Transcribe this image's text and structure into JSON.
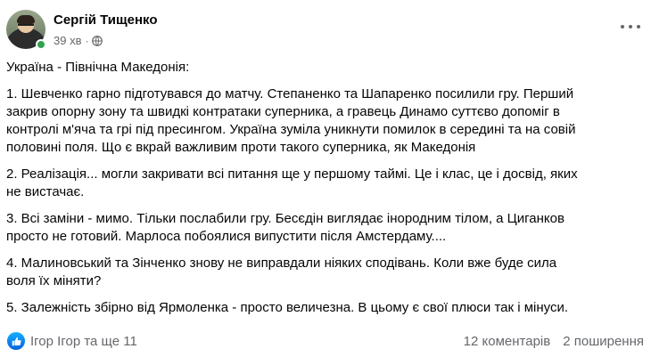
{
  "post": {
    "author": "Сергій Тищенко",
    "time": "39 хв",
    "separator": "·",
    "privacy_icon": "globe-icon",
    "more_icon": "more-options-icon",
    "paragraphs": [
      "Україна - Північна Македонія:",
      "1. Шевченко гарно підготувався до матчу. Степаненко та Шапаренко посилили гру. Перший\nзакрив опорну зону та швидкі контратаки суперника, а гравець Динамо суттєво допоміг в\nконтролі м'яча та грі під пресингом. Україна зуміла уникнути помилок в середині та на совій\nполовині поля. Що є вкрай важливим проти такого суперника, як Македонія",
      "2. Реалізація... могли закривати всі питання ще у першому таймі. Це і клас, це і досвід, яких\nне вистачає.",
      "3. Всі заміни - мимо. Тільки послабили гру. Бесєдін виглядає інородним тілом, а Циганков\nпросто не готовий. Марлоса побоялися випустити після Амстердаму....",
      "4. Малиновський та Зінченко знову не виправдали ніяких сподівань. Коли вже буде сила\nволя їх міняти?",
      "5. Залежність збірно від Ярмоленка - просто величезна. В цьому є свої плюси так і мінуси."
    ]
  },
  "footer": {
    "reaction_icon": "like-icon",
    "reaction_names": "Ігор Ігор та ще 11",
    "comments": "12 коментарів",
    "shares": "2 поширення"
  },
  "colors": {
    "text": "#050505",
    "secondary_text": "#65676b",
    "like_blue": "#0866ff",
    "online_green": "#31a24c"
  }
}
